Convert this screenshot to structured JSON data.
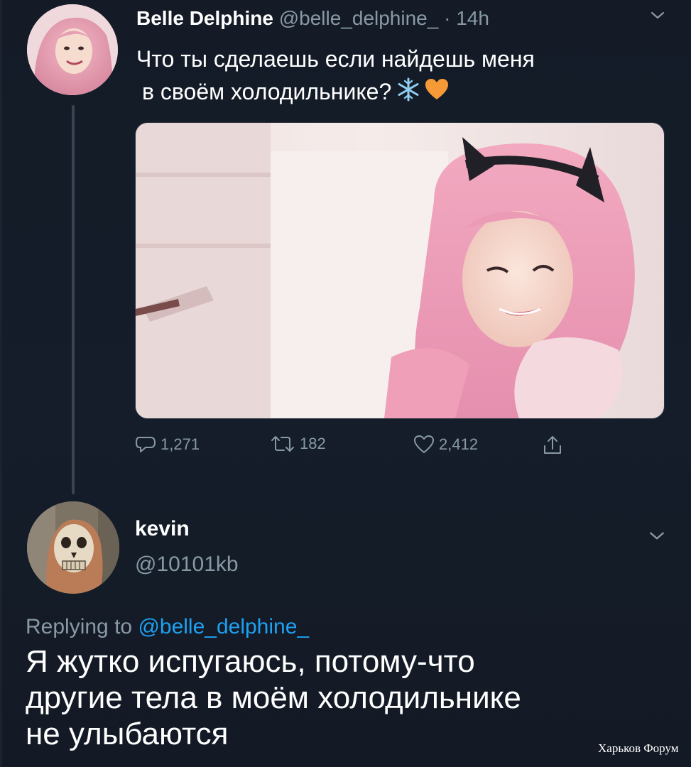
{
  "tweet": {
    "author_name": "Belle Delphine",
    "author_handle": "@belle_delphine_",
    "separator": "·",
    "time": "14h",
    "text_line1": "Что ты сделаешь если найдешь меня",
    "text_line2": "в своём холодильнике?",
    "emojis": [
      "snowflake-icon",
      "orange-heart-icon"
    ],
    "stats": {
      "replies": "1,271",
      "retweets": "182",
      "likes": "2,412"
    }
  },
  "reply": {
    "author_name": "kevin",
    "author_handle": "@10101kb",
    "replying_prefix": "Replying to",
    "replying_to": "@belle_delphine_",
    "text_line1": "Я жутко испугаюсь, потому-что",
    "text_line2": "другие тела в моём холодильнике",
    "text_line3": "не улыбаются"
  },
  "watermark": "Харьков Форум",
  "colors": {
    "background": "#15202b",
    "secondary_text": "#8899a6",
    "link": "#1da1f2",
    "primary_text": "#ffffff"
  }
}
